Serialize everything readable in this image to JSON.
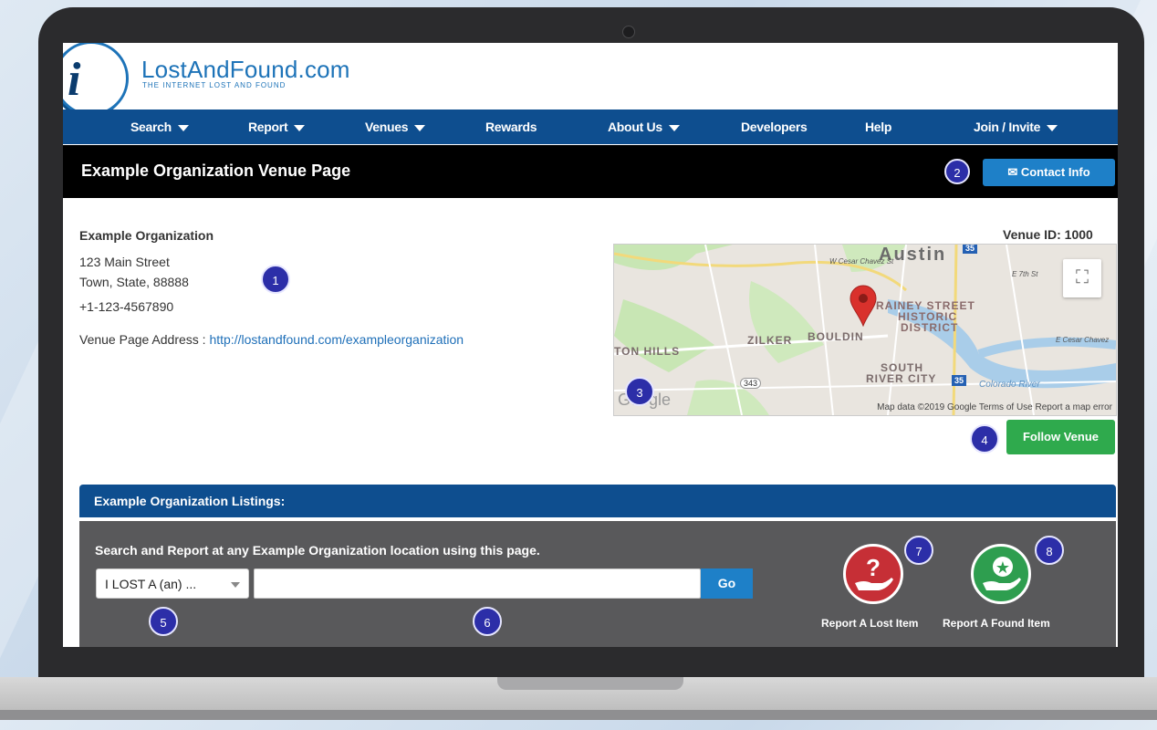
{
  "site": {
    "logo_letter": "i",
    "logo_name": "LostAndFound.com",
    "logo_tagline": "THE INTERNET LOST AND FOUND"
  },
  "nav": {
    "items": [
      {
        "label": "Search",
        "has_caret": true
      },
      {
        "label": "Report",
        "has_caret": true
      },
      {
        "label": "Venues",
        "has_caret": true
      },
      {
        "label": "Rewards",
        "has_caret": false
      },
      {
        "label": "About Us",
        "has_caret": true
      },
      {
        "label": "Developers",
        "has_caret": false
      },
      {
        "label": "Help",
        "has_caret": false
      },
      {
        "label": "Join / Invite",
        "has_caret": true
      }
    ]
  },
  "page": {
    "title": "Example Organization Venue Page",
    "contact_label": "Contact Info",
    "contact_icon": "envelope-icon"
  },
  "venue": {
    "name": "Example Organization",
    "street": "123 Main Street",
    "city_line": "Town, State, 88888",
    "phone": "+1-123-4567890",
    "address_label": "Venue Page Address :",
    "address_url": "http://lostandfound.com/exampleorganization",
    "id_label": "Venue ID: 1000",
    "follow_label": "Follow Venue"
  },
  "map": {
    "labels": {
      "city": "Austin",
      "rainey1": "RAINEY STREET",
      "rainey2": "HISTORIC",
      "rainey3": "DISTRICT",
      "zilker": "ZILKER",
      "bouldin": "BOULDIN",
      "ton_hills": "TON HILLS",
      "south": "SOUTH",
      "river_city": "RIVER CITY",
      "cesar": "W Cesar Chavez St",
      "seventh": "E 7th St",
      "e_cesar": "E Cesar Chavez",
      "colorado": "Colorado River",
      "google": "Google",
      "route_343": "343",
      "route_35": "35"
    },
    "footer": "Map data ©2019 Google   Terms of Use   Report a map error",
    "fullscreen_icon": "fullscreen-icon",
    "pin_icon": "map-pin-icon"
  },
  "listings": {
    "title": "Example Organization Listings:",
    "instruction": "Search and Report at any Example Organization location using this page.",
    "select_value": "I LOST A (an) ...",
    "search_placeholder": "",
    "go_label": "Go",
    "lost_label": "Report A Lost Item",
    "found_label": "Report A Found Item",
    "lost_icon": "question-hand-icon",
    "found_icon": "star-hand-icon"
  },
  "badges": [
    "1",
    "2",
    "3",
    "4",
    "5",
    "6",
    "7",
    "8"
  ],
  "colors": {
    "nav_blue": "#0e4e8f",
    "button_blue": "#1e80c8",
    "follow_green": "#2faa4d",
    "lost_red": "#c62f36",
    "found_green": "#2e9e4f",
    "badge_purple": "#2c2ea8"
  }
}
